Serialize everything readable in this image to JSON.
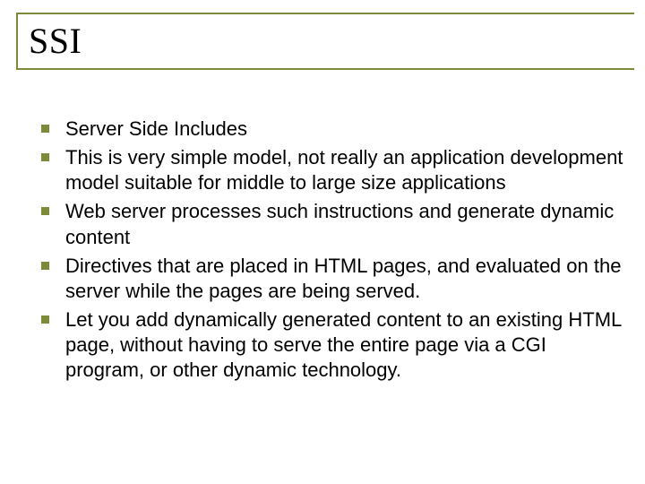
{
  "title": "SSI",
  "bullets": [
    "Server Side Includes",
    "This is very simple model, not really an application development model suitable for middle to large size applications",
    "Web server processes such instructions and generate dynamic content",
    "Directives that are placed in HTML pages, and evaluated on the server while the pages are being served.",
    "Let you add dynamically generated content to an existing HTML page, without having to serve the entire page via a CGI program, or other dynamic technology."
  ]
}
